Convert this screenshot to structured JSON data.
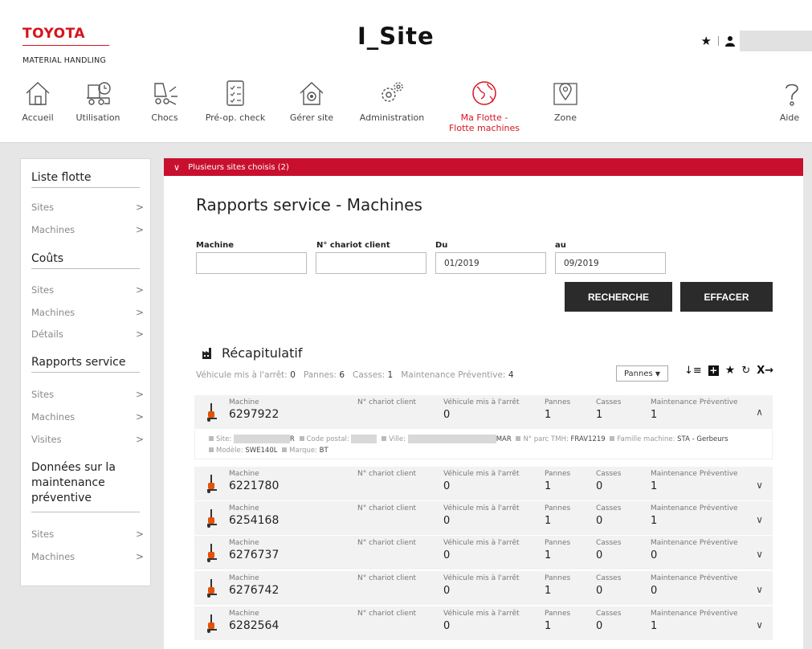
{
  "brand": {
    "name": "TOYOTA",
    "sub": "MATERIAL HANDLING"
  },
  "app_title": "I_Site",
  "nav": [
    {
      "label": "Accueil",
      "icon": "home-icon"
    },
    {
      "label": "Utilisation",
      "icon": "forklift-clock-icon"
    },
    {
      "label": "Chocs",
      "icon": "forklift-impact-icon"
    },
    {
      "label": "Pré-op. check",
      "icon": "checklist-icon"
    },
    {
      "label": "Gérer site",
      "icon": "site-settings-icon"
    },
    {
      "label": "Administration",
      "icon": "gears-icon"
    },
    {
      "label": "Ma Flotte -",
      "label2": "Flotte machines",
      "icon": "globe-icon",
      "active": true
    },
    {
      "label": "Zone",
      "icon": "map-pin-icon"
    },
    {
      "label": "Aide",
      "icon": "help-icon"
    }
  ],
  "sidebar": {
    "sections": [
      {
        "title": "Liste flotte",
        "items": [
          "Sites",
          "Machines"
        ]
      },
      {
        "title": "Coûts",
        "items": [
          "Sites",
          "Machines",
          "Détails"
        ]
      },
      {
        "title": "Rapports service",
        "items": [
          "Sites",
          "Machines",
          "Visites"
        ]
      },
      {
        "title_lines": [
          "Données sur la",
          "maintenance",
          "préventive"
        ],
        "items": [
          "Sites",
          "Machines"
        ]
      }
    ]
  },
  "main": {
    "banner": "Plusieurs sites choisis (2)",
    "title": "Rapports service - Machines",
    "filters": {
      "machine_label": "Machine",
      "client_label": "N° chariot client",
      "from_label": "Du",
      "to_label": "au",
      "from_value": "01/2019",
      "to_value": "09/2019",
      "search_btn": "RECHERCHE",
      "clear_btn": "EFFACER"
    },
    "recap": {
      "title": "Récapitulatif",
      "stopped_label": "Véhicule mis à l'arrêt:",
      "stopped": "0",
      "pannes_label": "Pannes:",
      "pannes": "6",
      "casses_label": "Casses:",
      "casses": "1",
      "maint_label": "Maintenance Préventive:",
      "maint": "4",
      "dropdown": "Pannes"
    },
    "columns": {
      "machine": "Machine",
      "client": "N° chariot client",
      "stopped": "Véhicule mis à l'arrêt",
      "pannes": "Pannes",
      "casses": "Casses",
      "maint": "Maintenance Préventive"
    },
    "rows": [
      {
        "id": "6297922",
        "stopped": "0",
        "pannes": "1",
        "casses": "1",
        "maint": "1",
        "expanded": true
      },
      {
        "id": "6221780",
        "stopped": "0",
        "pannes": "1",
        "casses": "0",
        "maint": "1"
      },
      {
        "id": "6254168",
        "stopped": "0",
        "pannes": "1",
        "casses": "0",
        "maint": "1"
      },
      {
        "id": "6276737",
        "stopped": "0",
        "pannes": "1",
        "casses": "0",
        "maint": "0"
      },
      {
        "id": "6276742",
        "stopped": "0",
        "pannes": "1",
        "casses": "0",
        "maint": "0"
      },
      {
        "id": "6282564",
        "stopped": "0",
        "pannes": "1",
        "casses": "0",
        "maint": "1"
      }
    ],
    "details": {
      "site_label": "Site:",
      "site_tail": "R",
      "postal_label": "Code postal:",
      "city_label": "Ville:",
      "city_tail": "MAR",
      "parc_label": "N° parc TMH:",
      "parc_value": "FRAV1219",
      "famille_label": "Famille machine:",
      "famille_value": "STA - Gerbeurs",
      "modele_label": "Modèle:",
      "modele_value": "SWE140L",
      "marque_label": "Marque:",
      "marque_value": "BT"
    }
  }
}
